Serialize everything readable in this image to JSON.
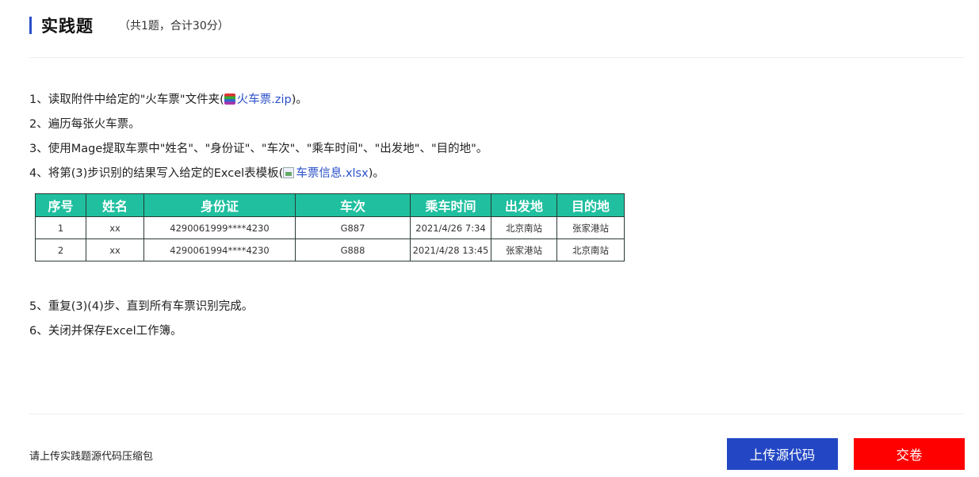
{
  "header": {
    "title": "实践题",
    "subtitle": "（共1题，合计30分）"
  },
  "steps_before": {
    "s1_prefix": "1、读取附件中给定的\"火车票\"文件夹(",
    "s1_link": "火车票.zip",
    "s1_suffix": ")。",
    "s2": "2、遍历每张火车票。",
    "s3": "3、使用Mage提取车票中\"姓名\"、\"身份证\"、\"车次\"、\"乘车时间\"、\"出发地\"、\"目的地\"。",
    "s4_prefix": "4、将第(3)步识别的结果写入给定的Excel表模板(",
    "s4_link": "车票信息.xlsx",
    "s4_suffix": ")。"
  },
  "table": {
    "headers": [
      "序号",
      "姓名",
      "身份证",
      "车次",
      "乘车时间",
      "出发地",
      "目的地"
    ],
    "rows": [
      [
        "1",
        "xx",
        "4290061999****4230",
        "G887",
        "2021/4/26 7:34",
        "北京南站",
        "张家港站"
      ],
      [
        "2",
        "xx",
        "4290061994****4230",
        "G888",
        "2021/4/28 13:45",
        "张家港站",
        "北京南站"
      ]
    ],
    "header_color": "#1fbf9f"
  },
  "steps_after": {
    "s5": "5、重复(3)(4)步、直到所有车票识别完成。",
    "s6": "6、关闭并保存Excel工作簿。"
  },
  "footer": {
    "hint": "请上传实践题源代码压缩包",
    "upload_label": "上传源代码",
    "submit_label": "交卷"
  },
  "icons": {
    "zip": "zip-archive-icon",
    "image": "broken-image-icon"
  },
  "colors": {
    "accent": "#2a4fc9",
    "upload_button": "#2347c4",
    "submit_button": "#ff0000",
    "link": "#2a4fc9"
  }
}
